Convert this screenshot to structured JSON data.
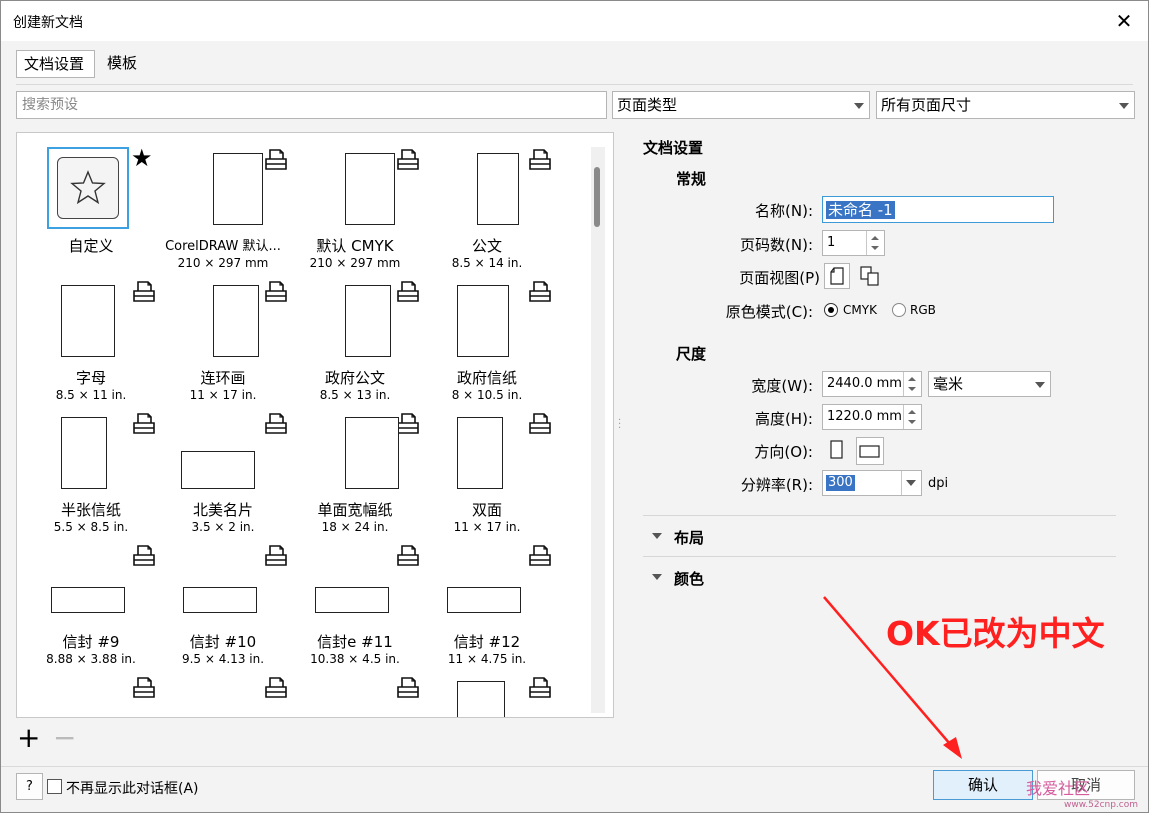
{
  "window": {
    "title": "创建新文档"
  },
  "tabs": [
    {
      "label": "文档设置"
    },
    {
      "label": "模板"
    }
  ],
  "filters": {
    "search_placeholder": "搜索预设",
    "page_type": "页面类型",
    "page_size": "所有页面尺寸"
  },
  "presets": [
    {
      "name": "自定义",
      "size": ""
    },
    {
      "name": "CorelDRAW 默认...",
      "size": "210 × 297 mm"
    },
    {
      "name": "默认 CMYK",
      "size": "210 × 297 mm"
    },
    {
      "name": "公文",
      "size": "8.5 × 14 in."
    },
    {
      "name": "字母",
      "size": "8.5 × 11 in."
    },
    {
      "name": "连环画",
      "size": "11 × 17 in."
    },
    {
      "name": "政府公文",
      "size": "8.5 × 13 in."
    },
    {
      "name": "政府信纸",
      "size": "8 × 10.5 in."
    },
    {
      "name": "半张信纸",
      "size": "5.5 × 8.5 in."
    },
    {
      "name": "北美名片",
      "size": "3.5 × 2 in."
    },
    {
      "name": "单面宽幅纸",
      "size": "18 × 24 in."
    },
    {
      "name": "双面",
      "size": "11 × 17 in."
    },
    {
      "name": "信封 #9",
      "size": "8.88 × 3.88 in."
    },
    {
      "name": "信封 #10",
      "size": "9.5 × 4.13 in."
    },
    {
      "name": "信封e #11",
      "size": "10.38 × 4.5 in."
    },
    {
      "name": "信封 #12",
      "size": "11 × 4.75 in."
    },
    {
      "name": "",
      "size": ""
    },
    {
      "name": "",
      "size": ""
    },
    {
      "name": "",
      "size": ""
    },
    {
      "name": "",
      "size": ""
    }
  ],
  "settings": {
    "heading": "文档设置",
    "general": {
      "heading": "常规",
      "name_label": "名称(N):",
      "name_value": "未命名 -1",
      "pages_label": "页码数(N):",
      "pages_value": "1",
      "view_label": "页面视图(P)",
      "color_mode_label": "原色模式(C):",
      "color_mode_options": [
        "CMYK",
        "RGB"
      ],
      "color_mode_selected": "CMYK"
    },
    "dimensions": {
      "heading": "尺度",
      "width_label": "宽度(W):",
      "width_value": "2440.0 mm",
      "units": "毫米",
      "height_label": "高度(H):",
      "height_value": "1220.0 mm",
      "orientation_label": "方向(O):",
      "resolution_label": "分辨率(R):",
      "resolution_value": "300",
      "resolution_unit": "dpi"
    },
    "layout": {
      "heading": "布局"
    },
    "color": {
      "heading": "颜色"
    }
  },
  "footer": {
    "help": "?",
    "dont_show": "不再显示此对话框(A)",
    "ok": "确认",
    "cancel": "取消"
  },
  "annotation": {
    "text": "OK已改为中文",
    "color": "#ff2020"
  },
  "watermark": {
    "text": "我爱社区",
    "url": "www.52cnp.com"
  }
}
